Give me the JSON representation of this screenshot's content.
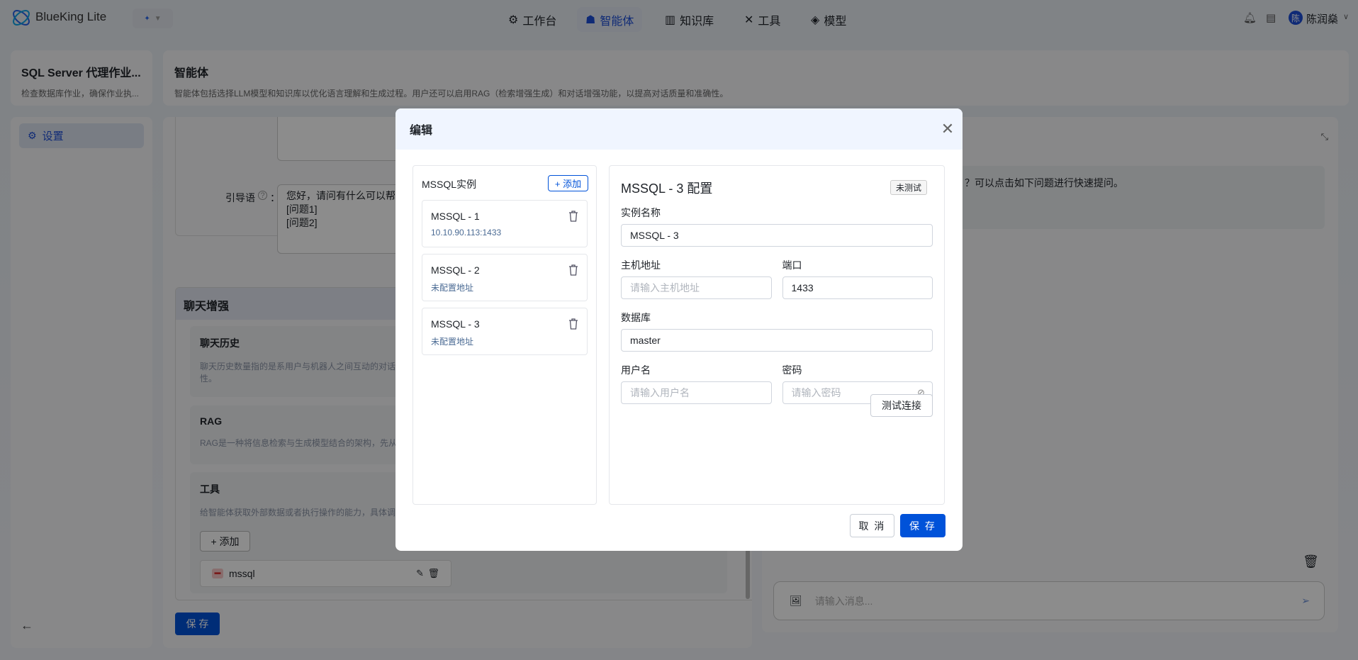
{
  "app": {
    "name": "BlueKing Lite"
  },
  "nav": [
    {
      "label": "工作台",
      "icon": "robot-icon"
    },
    {
      "label": "智能体",
      "icon": "agent-icon",
      "active": true
    },
    {
      "label": "知识库",
      "icon": "library-icon"
    },
    {
      "label": "工具",
      "icon": "tools-icon"
    },
    {
      "label": "模型",
      "icon": "layers-icon"
    }
  ],
  "user": {
    "avatar": "陈",
    "name": "陈润燊"
  },
  "agent": {
    "title": "SQL Server 代理作业...",
    "subtitle": "检查数据库作业，确保作业执..."
  },
  "page": {
    "title": "智能体",
    "description": "智能体包括选择LLM模型和知识库以优化语言理解和生成过程。用户还可以启用RAG（检索增强生成）和对话增强功能，以提高对话质量和准确性。"
  },
  "sidebar": {
    "items": [
      {
        "label": "设置"
      }
    ]
  },
  "form": {
    "guide_label": "引导语",
    "guide_suffix": "：",
    "guide_lines": [
      "您好，请问有什么可以帮",
      "[问题1]",
      "[问题2]"
    ],
    "enhance_title": "聊天增强",
    "history": {
      "title": "聊天历史",
      "desc": "聊天历史数量指的是系用户与机器人之间互动的对话",
      "desc2": "性。"
    },
    "rag": {
      "title": "RAG",
      "desc": "RAG是一种将信息检索与生成模型结合的架构，先从"
    },
    "tools": {
      "title": "工具",
      "desc": "给智能体获取外部数据或者执行操作的能力，具体调",
      "add": "+ 添加",
      "items": [
        {
          "name": "mssql"
        }
      ]
    },
    "save": "保 存"
  },
  "chat": {
    "message": "？可以点击如下问题进行快速提问。",
    "input_placeholder": "请输入消息..."
  },
  "modal": {
    "title": "编辑",
    "list_title": "MSSQL实例",
    "add": "+ 添加",
    "instances": [
      {
        "name": "MSSQL - 1",
        "address": "10.10.90.113:1433"
      },
      {
        "name": "MSSQL - 2",
        "address": "未配置地址"
      },
      {
        "name": "MSSQL - 3",
        "address": "未配置地址"
      }
    ],
    "config": {
      "title": "MSSQL - 3 配置",
      "status": "未测试",
      "name_label": "实例名称",
      "name_value": "MSSQL - 3",
      "host_label": "主机地址",
      "host_placeholder": "请输入主机地址",
      "port_label": "端口",
      "port_value": "1433",
      "db_label": "数据库",
      "db_value": "master",
      "user_label": "用户名",
      "user_placeholder": "请输入用户名",
      "pwd_label": "密码",
      "pwd_placeholder": "请输入密码",
      "test": "测试连接"
    },
    "cancel": "取 消",
    "save": "保 存"
  },
  "colors": {
    "primary": "#0052d9",
    "overlay": "rgba(0,0,0,0.45)"
  }
}
